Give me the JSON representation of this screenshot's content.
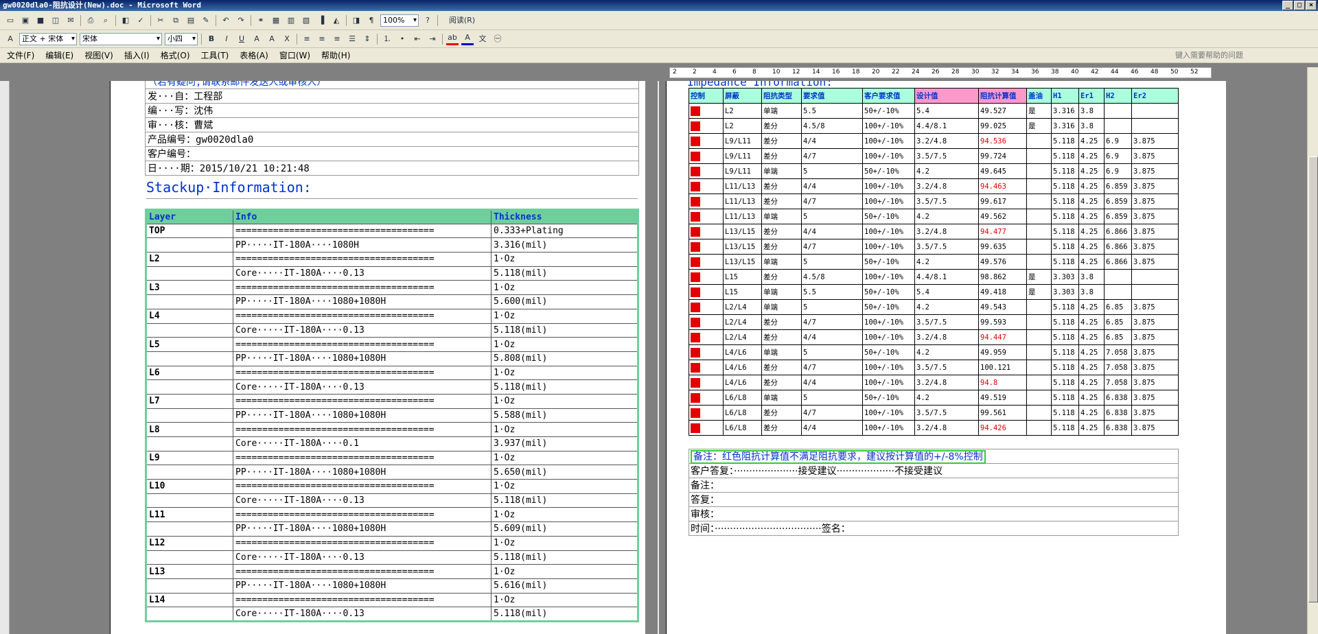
{
  "window": {
    "title": "gw0020dla0-阻抗设计(New).doc - Microsoft Word"
  },
  "toolbar": {
    "zoom": "100%",
    "read_label": "阅读(R)"
  },
  "format_bar": {
    "style_value": "正文 + 宋体",
    "font_value": "宋体",
    "size_value": "小四"
  },
  "menu": {
    "items": [
      "文件(F)",
      "编辑(E)",
      "视图(V)",
      "插入(I)",
      "格式(O)",
      "工具(T)",
      "表格(A)",
      "窗口(W)",
      "帮助(H)"
    ],
    "help_placeholder": "键入需要帮助的问题"
  },
  "ruler": {
    "labels": [
      "2",
      "2",
      "4",
      "6",
      "8",
      "10",
      "12",
      "14",
      "16",
      "18",
      "20",
      "22",
      "24",
      "26",
      "28",
      "30",
      "32",
      "34",
      "36",
      "38",
      "40",
      "42",
      "44",
      "46",
      "48",
      "50",
      "52"
    ]
  },
  "left_doc": {
    "header_rows": [
      "（若有疑问,请联系邮件发送人或审核人）",
      "发···自：工程部",
      "编···写：沈伟",
      "审···核：曹斌",
      "产品编号：gw0020dla0",
      "客户编号：",
      "日····期：2015/10/21 10:21:48"
    ],
    "stackup_title": "Stackup·Information:",
    "stackup_headers": [
      "Layer",
      "Info",
      "Thickness"
    ],
    "stackup_rows": [
      [
        "TOP",
        "=====================================",
        "0.333+Plating"
      ],
      [
        "",
        "PP·····IT-180A····1080H",
        "3.316(mil)"
      ],
      [
        "L2",
        "=====================================",
        "1·Oz"
      ],
      [
        "",
        "Core·····IT-180A····0.13",
        "5.118(mil)"
      ],
      [
        "L3",
        "=====================================",
        "1·Oz"
      ],
      [
        "",
        "PP·····IT-180A····1080+1080H",
        "5.600(mil)"
      ],
      [
        "L4",
        "=====================================",
        "1·Oz"
      ],
      [
        "",
        "Core·····IT-180A····0.13",
        "5.118(mil)"
      ],
      [
        "L5",
        "=====================================",
        "1·Oz"
      ],
      [
        "",
        "PP·····IT-180A····1080+1080H",
        "5.808(mil)"
      ],
      [
        "L6",
        "=====================================",
        "1·Oz"
      ],
      [
        "",
        "Core·····IT-180A····0.13",
        "5.118(mil)"
      ],
      [
        "L7",
        "=====================================",
        "1·Oz"
      ],
      [
        "",
        "PP·····IT-180A····1080+1080H",
        "5.588(mil)"
      ],
      [
        "L8",
        "=====================================",
        "1·Oz"
      ],
      [
        "",
        "Core·····IT-180A····0.1",
        "3.937(mil)"
      ],
      [
        "L9",
        "=====================================",
        "1·Oz"
      ],
      [
        "",
        "PP·····IT-180A····1080+1080H",
        "5.650(mil)"
      ],
      [
        "L10",
        "=====================================",
        "1·Oz"
      ],
      [
        "",
        "Core·····IT-180A····0.13",
        "5.118(mil)"
      ],
      [
        "L11",
        "=====================================",
        "1·Oz"
      ],
      [
        "",
        "PP·····IT-180A····1080+1080H",
        "5.609(mil)"
      ],
      [
        "L12",
        "=====================================",
        "1·Oz"
      ],
      [
        "",
        "Core·····IT-180A····0.13",
        "5.118(mil)"
      ],
      [
        "L13",
        "=====================================",
        "1·Oz"
      ],
      [
        "",
        "PP·····IT-180A····1080+1080H",
        "5.616(mil)"
      ],
      [
        "L14",
        "=====================================",
        "1·Oz"
      ],
      [
        "",
        "Core·····IT-180A····0.13",
        "5.118(mil)"
      ]
    ]
  },
  "right_doc": {
    "imp_headers": [
      "控制",
      "屏蔽",
      "阻抗类型",
      "要求值",
      "客户要求值",
      "设计值",
      "阻抗计算值",
      "盖油",
      "H1",
      "Er1",
      "H2",
      "Er2"
    ],
    "imp_rows": [
      [
        "L2",
        "单端",
        "5.5",
        "50+/-10%",
        "5.4",
        "49.527",
        "是",
        "3.316",
        "3.8",
        "",
        "",
        false
      ],
      [
        "L2",
        "差分",
        "4.5/8",
        "100+/-10%",
        "4.4/8.1",
        "99.025",
        "是",
        "3.316",
        "3.8",
        "",
        "",
        false
      ],
      [
        "L9/L11",
        "差分",
        "4/4",
        "100+/-10%",
        "3.2/4.8",
        "94.536",
        "",
        "5.118",
        "4.25",
        "6.9",
        "3.875",
        true
      ],
      [
        "L9/L11",
        "差分",
        "4/7",
        "100+/-10%",
        "3.5/7.5",
        "99.724",
        "",
        "5.118",
        "4.25",
        "6.9",
        "3.875",
        false
      ],
      [
        "L9/L11",
        "单端",
        "5",
        "50+/-10%",
        "4.2",
        "49.645",
        "",
        "5.118",
        "4.25",
        "6.9",
        "3.875",
        false
      ],
      [
        "L11/L13",
        "差分",
        "4/4",
        "100+/-10%",
        "3.2/4.8",
        "94.463",
        "",
        "5.118",
        "4.25",
        "6.859",
        "3.875",
        true
      ],
      [
        "L11/L13",
        "差分",
        "4/7",
        "100+/-10%",
        "3.5/7.5",
        "99.617",
        "",
        "5.118",
        "4.25",
        "6.859",
        "3.875",
        false
      ],
      [
        "L11/L13",
        "单端",
        "5",
        "50+/-10%",
        "4.2",
        "49.562",
        "",
        "5.118",
        "4.25",
        "6.859",
        "3.875",
        false
      ],
      [
        "L13/L15",
        "差分",
        "4/4",
        "100+/-10%",
        "3.2/4.8",
        "94.477",
        "",
        "5.118",
        "4.25",
        "6.866",
        "3.875",
        true
      ],
      [
        "L13/L15",
        "差分",
        "4/7",
        "100+/-10%",
        "3.5/7.5",
        "99.635",
        "",
        "5.118",
        "4.25",
        "6.866",
        "3.875",
        false
      ],
      [
        "L13/L15",
        "单端",
        "5",
        "50+/-10%",
        "4.2",
        "49.576",
        "",
        "5.118",
        "4.25",
        "6.866",
        "3.875",
        false
      ],
      [
        "L15",
        "差分",
        "4.5/8",
        "100+/-10%",
        "4.4/8.1",
        "98.862",
        "是",
        "3.303",
        "3.8",
        "",
        "",
        false
      ],
      [
        "L15",
        "单端",
        "5.5",
        "50+/-10%",
        "5.4",
        "49.418",
        "是",
        "3.303",
        "3.8",
        "",
        "",
        false
      ],
      [
        "L2/L4",
        "单端",
        "5",
        "50+/-10%",
        "4.2",
        "49.543",
        "",
        "5.118",
        "4.25",
        "6.85",
        "3.875",
        false
      ],
      [
        "L2/L4",
        "差分",
        "4/7",
        "100+/-10%",
        "3.5/7.5",
        "99.593",
        "",
        "5.118",
        "4.25",
        "6.85",
        "3.875",
        false
      ],
      [
        "L2/L4",
        "差分",
        "4/4",
        "100+/-10%",
        "3.2/4.8",
        "94.447",
        "",
        "5.118",
        "4.25",
        "6.85",
        "3.875",
        true
      ],
      [
        "L4/L6",
        "单端",
        "5",
        "50+/-10%",
        "4.2",
        "49.959",
        "",
        "5.118",
        "4.25",
        "7.058",
        "3.875",
        false
      ],
      [
        "L4/L6",
        "差分",
        "4/7",
        "100+/-10%",
        "3.5/7.5",
        "100.121",
        "",
        "5.118",
        "4.25",
        "7.058",
        "3.875",
        false
      ],
      [
        "L4/L6",
        "差分",
        "4/4",
        "100+/-10%",
        "3.2/4.8",
        "94.8",
        "",
        "5.118",
        "4.25",
        "7.058",
        "3.875",
        true
      ],
      [
        "L6/L8",
        "单端",
        "5",
        "50+/-10%",
        "4.2",
        "49.519",
        "",
        "5.118",
        "4.25",
        "6.838",
        "3.875",
        false
      ],
      [
        "L6/L8",
        "差分",
        "4/7",
        "100+/-10%",
        "3.5/7.5",
        "99.561",
        "",
        "5.118",
        "4.25",
        "6.838",
        "3.875",
        false
      ],
      [
        "L6/L8",
        "差分",
        "4/4",
        "100+/-10%",
        "3.2/4.8",
        "94.426",
        "",
        "5.118",
        "4.25",
        "6.838",
        "3.875",
        true
      ]
    ],
    "note": "备注：红色阻抗计算值不满足阻抗要求，建议按计算值的+/-8%控制",
    "customer_reply": "客户答复：·····················接受建议···················不接受建议",
    "rows": [
      "备注：",
      "答复：",
      "审核：",
      "时间：···································签名："
    ]
  }
}
